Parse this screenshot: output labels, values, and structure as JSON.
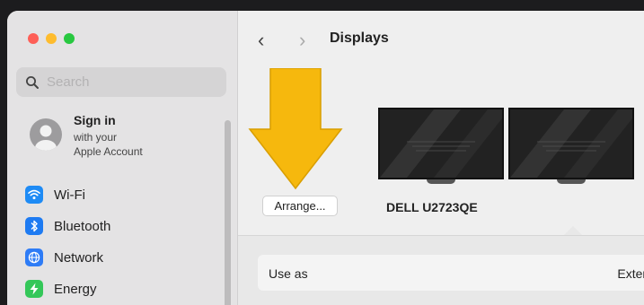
{
  "window": {
    "title": "Displays"
  },
  "sidebar": {
    "search_placeholder": "Search",
    "account": {
      "title": "Sign in",
      "line1": "with your",
      "line2": "Apple Account"
    },
    "items": [
      {
        "label": "Wi-Fi",
        "icon": "wifi-icon",
        "color": "#1e8bf5"
      },
      {
        "label": "Bluetooth",
        "icon": "bluetooth-icon",
        "color": "#1e7bf2"
      },
      {
        "label": "Network",
        "icon": "globe-icon",
        "color": "#2e7cf6"
      },
      {
        "label": "Energy",
        "icon": "bolt-icon",
        "color": "#34c759"
      }
    ]
  },
  "main": {
    "arrange_label": "Arrange...",
    "display_name": "DELL U2723QE",
    "settings": [
      {
        "label": "Use as",
        "value": "Extend"
      }
    ]
  },
  "colors": {
    "accent_arrow": "#f6b80d",
    "close": "#fe5f57",
    "minimize": "#febc2e",
    "zoom": "#28c840"
  }
}
